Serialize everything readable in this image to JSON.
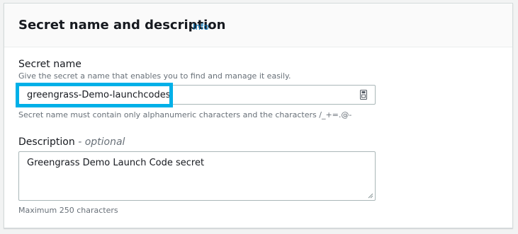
{
  "header": {
    "title": "Secret name and description",
    "info_link": "Info"
  },
  "secret_name": {
    "label": "Secret name",
    "description": "Give the secret a name that enables you to find and manage it easily.",
    "value": "greengrass-Demo-launchcodes",
    "constraint": "Secret name must contain only alphanumeric characters and the characters /_+=.@-",
    "icon": "password-manager-icon"
  },
  "description": {
    "label": "Description",
    "optional_label": "- optional",
    "value": "Greengrass Demo Launch Code secret",
    "constraint": "Maximum 250 characters"
  },
  "colors": {
    "highlight": "#00b0e8",
    "link": "#0073bb",
    "hint": "#687078"
  }
}
